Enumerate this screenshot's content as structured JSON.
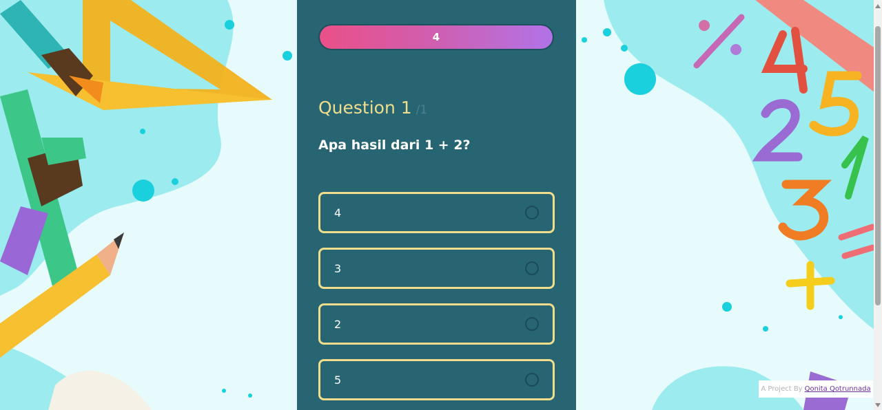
{
  "progress": {
    "text": "4",
    "fraction": 1.0
  },
  "question": {
    "heading": "Question 1",
    "total": "/1",
    "text": "Apa hasil dari 1 + 2?"
  },
  "options": [
    {
      "label": "4"
    },
    {
      "label": "3"
    },
    {
      "label": "2"
    },
    {
      "label": "5"
    }
  ],
  "credit": {
    "prefix": "A Project By",
    "author": "Qonita Qotrunnada"
  },
  "colors": {
    "panel": "#286573",
    "accent_yellow": "#f1de8d",
    "progress_start": "#ea5088",
    "progress_end": "#b173e8",
    "background": "#e8fbfc"
  },
  "icons": {
    "background_left": "art-supplies-illustration",
    "background_right": "math-numbers-illustration"
  }
}
